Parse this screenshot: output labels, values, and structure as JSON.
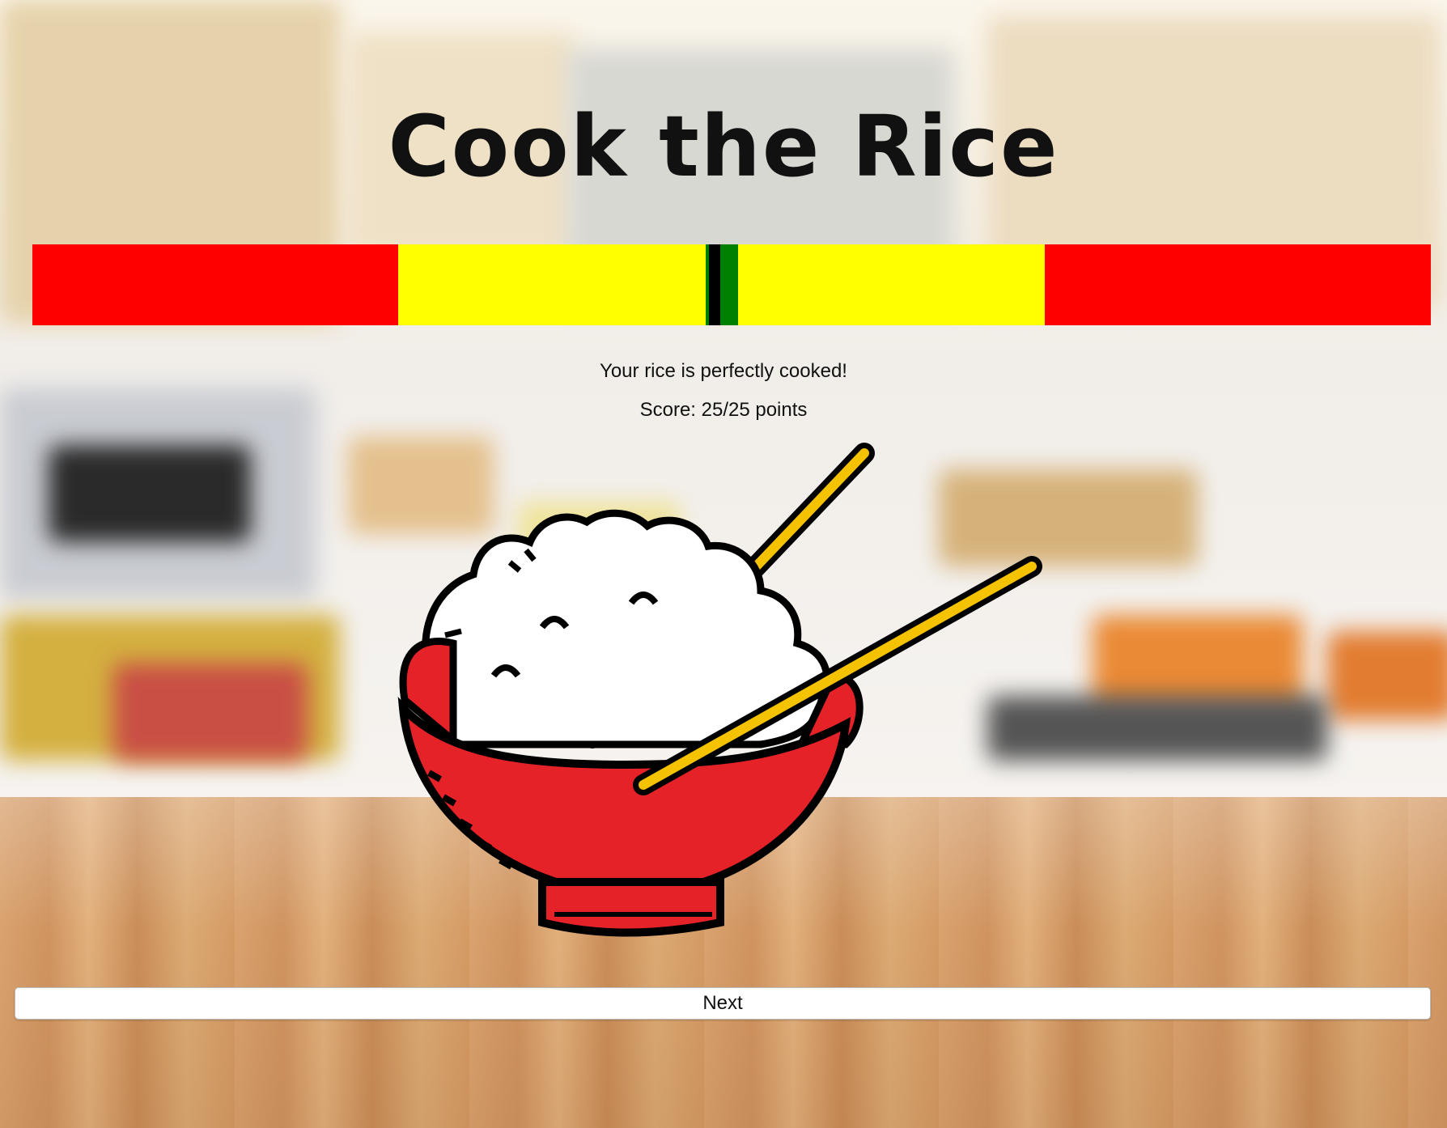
{
  "game": {
    "title": "Cook the Rice",
    "message": "Your rice is perfectly cooked!",
    "score": "Score: 25/25 points",
    "next_label": "Next"
  },
  "meter": {
    "zones": [
      {
        "name": "undercooked",
        "color": "#ff0000"
      },
      {
        "name": "almost",
        "color": "#ffff00"
      },
      {
        "name": "perfect",
        "color": "#008000"
      },
      {
        "name": "almost",
        "color": "#ffff00"
      },
      {
        "name": "overcooked",
        "color": "#ff0000"
      }
    ],
    "marker_color": "#000000",
    "marker_zone": "perfect"
  },
  "colors": {
    "bowl": "#e52228",
    "chopsticks": "#f5c200",
    "rice": "#ffffff"
  },
  "icons": {
    "bowl": "rice-bowl-icon"
  }
}
